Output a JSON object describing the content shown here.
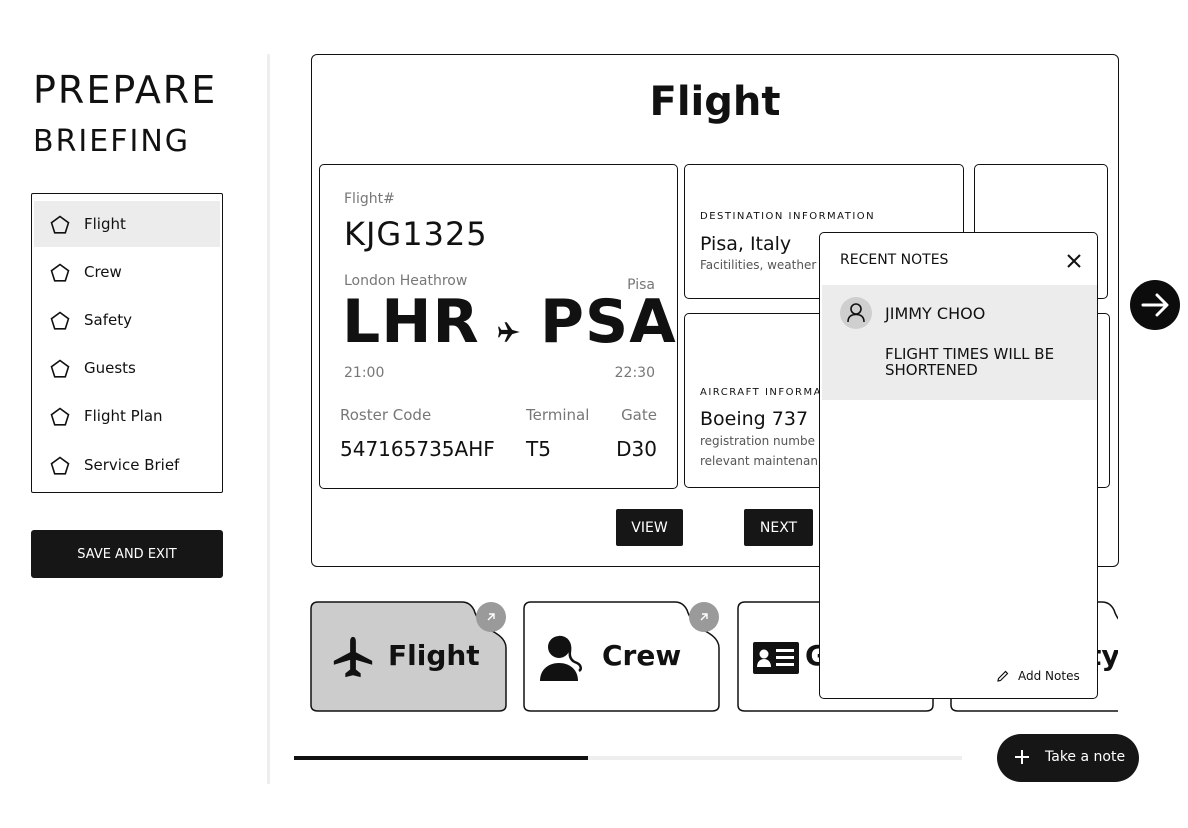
{
  "sidebar": {
    "title_line1": "PREPARE",
    "title_line2": "BRIEFING",
    "items": [
      {
        "label": "Flight",
        "active": true
      },
      {
        "label": "Crew",
        "active": false
      },
      {
        "label": "Safety",
        "active": false
      },
      {
        "label": "Guests",
        "active": false
      },
      {
        "label": "Flight Plan",
        "active": false
      },
      {
        "label": "Service Brief",
        "active": false
      }
    ],
    "save_label": "SAVE AND EXIT"
  },
  "main": {
    "title": "Flight",
    "flight": {
      "number_label": "Flight#",
      "number": "KJG1325",
      "origin_name": "London Heathrow",
      "destination_name": "Pisa",
      "origin_code": "LHR",
      "destination_code": "PSA",
      "departure_time": "21:00",
      "arrival_time": "22:30",
      "roster_label": "Roster Code",
      "roster_code": "547165735AHF",
      "terminal_label": "Terminal",
      "terminal": "T5",
      "gate_label": "Gate",
      "gate": "D30"
    },
    "destination": {
      "caption": "DESTINATION INFORMATION",
      "name": "Pisa, Italy",
      "details": "Facitilities, weather"
    },
    "aircraft": {
      "caption": "AIRCRAFT INFORMA",
      "model": "Boeing 737",
      "details_1": "registration numbe",
      "details_2": "relevant maintenan"
    },
    "view_label": "VIEW",
    "next_label": "NEXT"
  },
  "tiles": [
    {
      "label": "Flight",
      "icon": "airplane-icon",
      "selected": true
    },
    {
      "label": "Crew",
      "icon": "crew-icon",
      "selected": false
    },
    {
      "label": "G",
      "icon": "id-card-icon",
      "selected": false
    },
    {
      "label": "ty",
      "icon": "",
      "selected": false
    }
  ],
  "notes": {
    "title": "RECENT NOTES",
    "items": [
      {
        "author": "JIMMY CHOO",
        "text": "FLIGHT TIMES WILL BE SHORTENED"
      }
    ],
    "add_label": "Add Notes"
  },
  "progress": {
    "fraction": 0.44
  },
  "fab": {
    "label": "Take a note"
  },
  "colors": {
    "ink": "#111111",
    "dark_button": "#161616",
    "selected_bg": "#ececec",
    "tile_selected": "#cccccc",
    "badge": "#9a9a9a"
  }
}
